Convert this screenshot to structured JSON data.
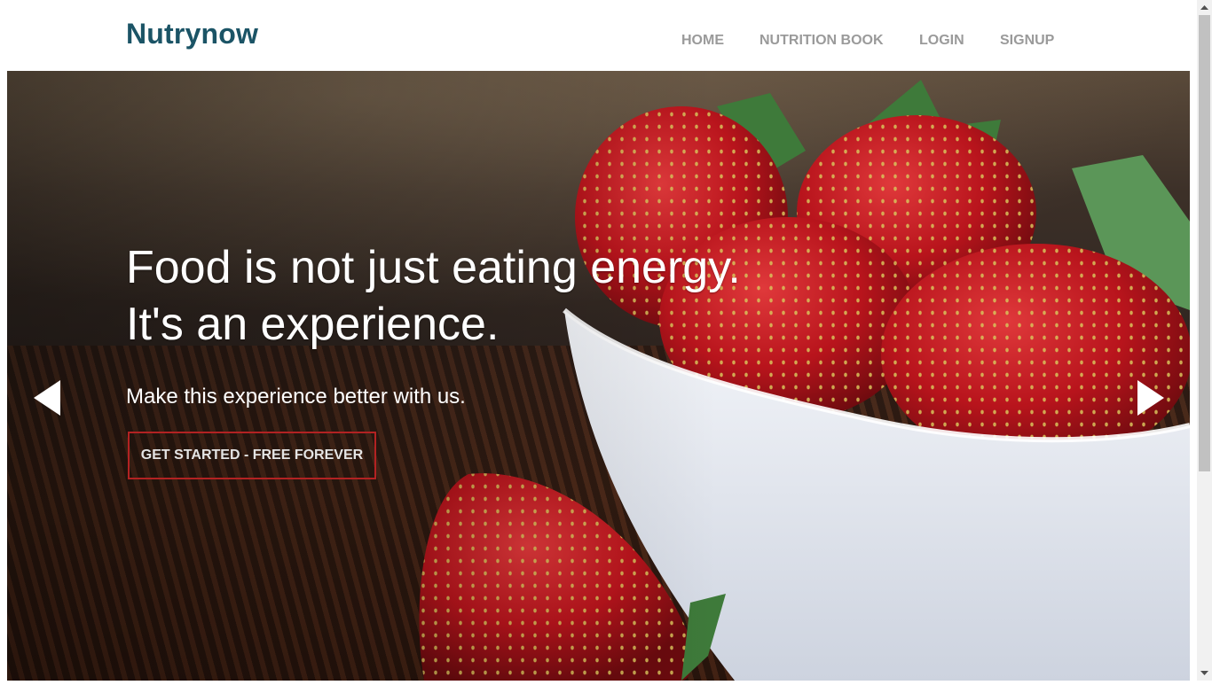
{
  "brand": {
    "name": "Nutrynow",
    "color": "#1b5466"
  },
  "nav": {
    "items": [
      {
        "label": "HOME"
      },
      {
        "label": "NUTRITION BOOK"
      },
      {
        "label": "LOGIN"
      },
      {
        "label": "SIGNUP"
      }
    ],
    "color": "#9a9a9a"
  },
  "hero": {
    "headline_line1": "Food is not just eating energy.",
    "headline_line2": "It's an experience.",
    "subtitle": "Make this experience better with us.",
    "cta_label": "GET STARTED - FREE FOREVER",
    "cta_border_color": "#b22222",
    "background_image": "strawberries-in-white-bowl",
    "prev_icon": "triangle-left-icon",
    "next_icon": "triangle-right-icon"
  },
  "scrollbar": {
    "visible": true
  }
}
